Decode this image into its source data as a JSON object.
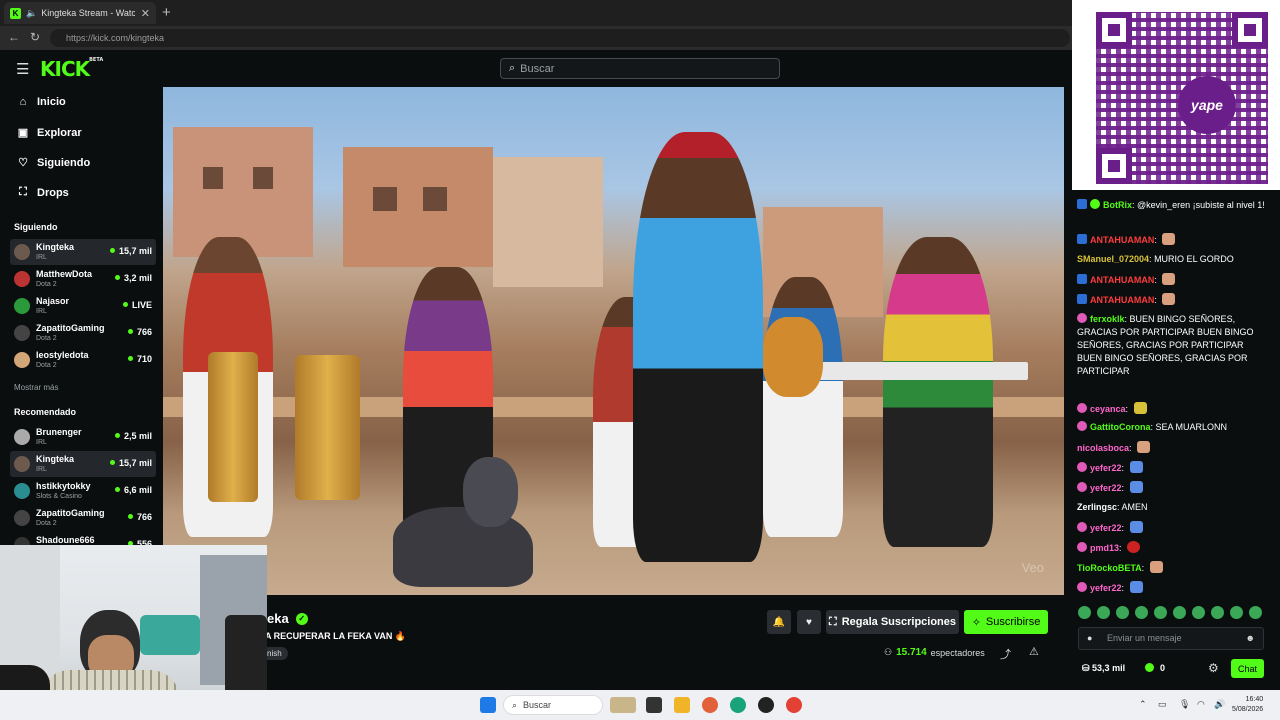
{
  "browser": {
    "tab_title": "Kingteka Stream - Watch Live",
    "tab_close": "✕",
    "new_tab": "+",
    "url": "https://kick.com/kingteka"
  },
  "header": {
    "logo_text": "KICK",
    "logo_badge": "BETA",
    "search_placeholder": "Buscar"
  },
  "sidebar": {
    "nav": [
      {
        "label": "Inicio",
        "icon": "home-icon"
      },
      {
        "label": "Explorar",
        "icon": "compass-icon"
      },
      {
        "label": "Siguiendo",
        "icon": "heart-icon"
      },
      {
        "label": "Drops",
        "icon": "gift-icon"
      }
    ],
    "following_title": "Siguiendo",
    "following": [
      {
        "name": "Kingteka",
        "category": "IRL",
        "viewers": "15,7 mil",
        "active": true
      },
      {
        "name": "MatthewDota",
        "category": "Dota 2",
        "viewers": "3,2 mil"
      },
      {
        "name": "Najasor",
        "category": "IRL",
        "viewers": "LIVE"
      },
      {
        "name": "ZapatitoGaming",
        "category": "Dota 2",
        "viewers": "766"
      },
      {
        "name": "leostyledota",
        "category": "Dota 2",
        "viewers": "710"
      }
    ],
    "show_more": "Mostrar más",
    "recommended_title": "Recomendado",
    "recommended": [
      {
        "name": "Brunenger",
        "category": "IRL",
        "viewers": "2,5 mil"
      },
      {
        "name": "Kingteka",
        "category": "IRL",
        "viewers": "15,7 mil",
        "active": true
      },
      {
        "name": "hstikkytokky",
        "category": "Slots & Casino",
        "viewers": "6,6 mil"
      },
      {
        "name": "ZapatitoGaming",
        "category": "Dota 2",
        "viewers": "766"
      },
      {
        "name": "Shadoune666",
        "category": "",
        "viewers": "556"
      }
    ]
  },
  "video": {
    "watermark": "Veo"
  },
  "stream": {
    "channel_name": "eka",
    "title": "A RECUPERAR LA FEKA VAN 🔥",
    "language_tag": "nish",
    "gift_label": "Regala Suscripciones",
    "subscribe_label": "Suscribirse",
    "viewers_count": "15.714",
    "viewers_label": "espectadores"
  },
  "qr": {
    "brand": "yape"
  },
  "chat": {
    "messages": [
      {
        "user": "BotRix",
        "color": "#53fc18",
        "badges": [
          "b",
          "g"
        ],
        "text": "@kevin_eren ¡subiste al nivel 1!"
      },
      {
        "user": "ANTAHUAMAN",
        "color": "#ff3b3b",
        "badges": [
          "b"
        ],
        "text": "",
        "emote": "e"
      },
      {
        "user": "SManuel_072004",
        "color": "#d8c13a",
        "badges": [],
        "text": "MURIO EL GORDO"
      },
      {
        "user": "ANTAHUAMAN",
        "color": "#ff3b3b",
        "badges": [
          "b"
        ],
        "text": "",
        "emote": "e"
      },
      {
        "user": "ANTAHUAMAN",
        "color": "#ff3b3b",
        "badges": [
          "b"
        ],
        "text": "",
        "emote": "e"
      },
      {
        "user": "ferxoklk",
        "color": "#53fc18",
        "badges": [
          "p"
        ],
        "text": "BUEN BINGO SEÑORES, GRACIAS POR PARTICIPAR BUEN BINGO SEÑORES, GRACIAS POR PARTICIPAR BUEN BINGO SEÑORES, GRACIAS POR PARTICIPAR"
      },
      {
        "user": "ceyanca",
        "color": "#ff66cc",
        "badges": [
          "p"
        ],
        "text": "",
        "emote": "y"
      },
      {
        "user": "GattitoCorona",
        "color": "#53fc18",
        "badges": [
          "p"
        ],
        "text": "SEA MUARLONN"
      },
      {
        "user": "nicolasboca",
        "color": "#ff66cc",
        "badges": [],
        "text": "",
        "emote": "e"
      },
      {
        "user": "yefer22",
        "color": "#ff66cc",
        "badges": [
          "p"
        ],
        "text": "",
        "emote": "b"
      },
      {
        "user": "yefer22",
        "color": "#ff66cc",
        "badges": [
          "p"
        ],
        "text": "",
        "emote": "b"
      },
      {
        "user": "Zerlingsc",
        "color": "#ffffff",
        "badges": [],
        "text": "AMEN"
      },
      {
        "user": "yefer22",
        "color": "#ff66cc",
        "badges": [
          "p"
        ],
        "text": "",
        "emote": "b"
      },
      {
        "user": "pmd13",
        "color": "#ff66cc",
        "badges": [
          "p"
        ],
        "text": "",
        "emote": "r"
      },
      {
        "user": "TioRockoBETA",
        "color": "#53fc18",
        "badges": [],
        "text": "",
        "emote": "e"
      },
      {
        "user": "yefer22",
        "color": "#ff66cc",
        "badges": [
          "p"
        ],
        "text": "",
        "emote": "b"
      }
    ],
    "input_placeholder": "Enviar un mensaje",
    "points": "53,3 mil",
    "kick_coins": "0",
    "chat_button": "Chat"
  },
  "taskbar": {
    "search_label": "Buscar",
    "time": "16:40",
    "date": "5/08/2026"
  },
  "colors": {
    "accent": "#53fc18",
    "background": "#0b0e0f"
  }
}
